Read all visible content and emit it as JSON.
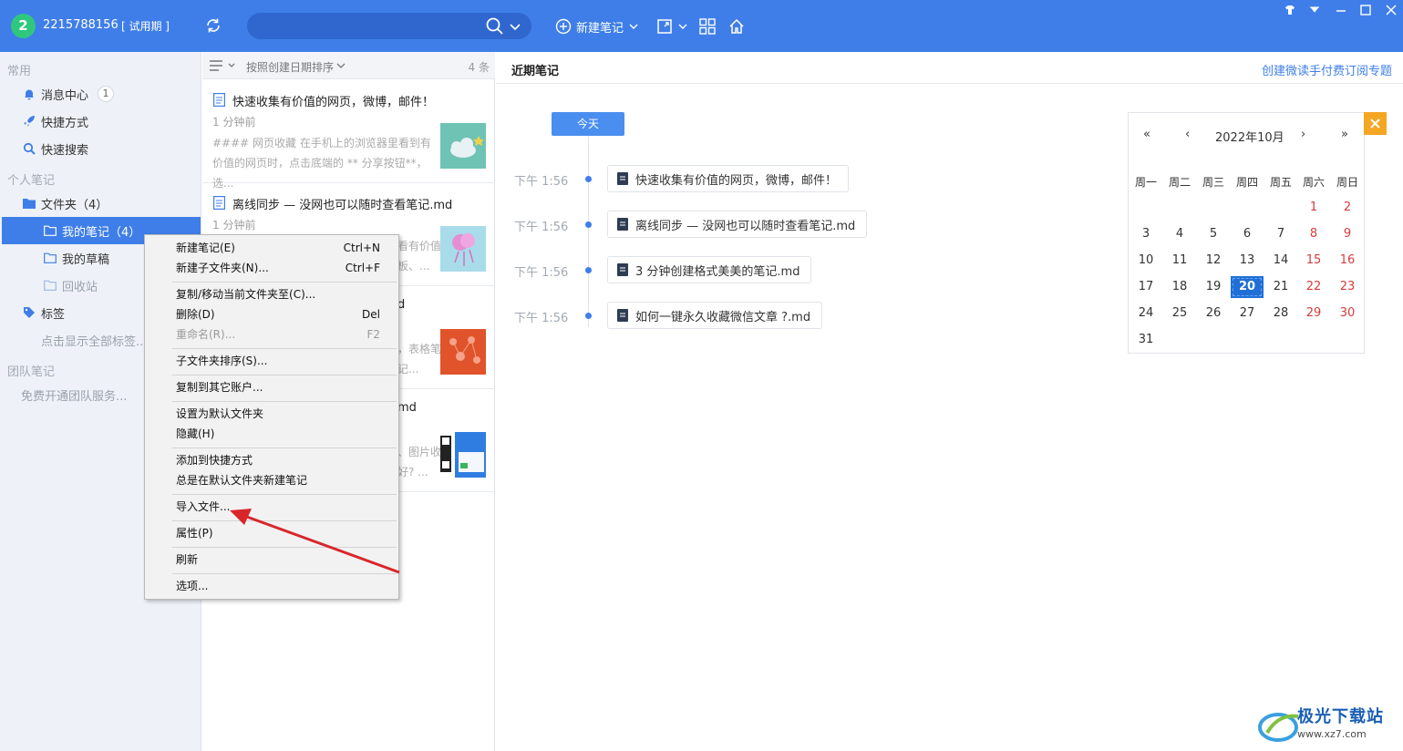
{
  "topbar": {
    "avatar_letter": "2",
    "user_id": "2215788156",
    "trial_label": "[ 试用期 ]",
    "search_placeholder": "",
    "new_note_label": "新建笔记"
  },
  "sidebar": {
    "common_title": "常用",
    "message_center": "消息中心",
    "message_count": "1",
    "shortcuts": "快捷方式",
    "quick_search": "快速搜索",
    "personal_title": "个人笔记",
    "folders": "文件夹（4）",
    "my_notes": "我的笔记（4）",
    "my_drafts": "我的草稿",
    "recycle_bin": "回收站",
    "tags": "标签",
    "tags_hint": "点击显示全部标签...",
    "team_title": "团队笔记",
    "team_hint": "免费开通团队服务..."
  },
  "notelist": {
    "sort_label": "按照创建日期排序",
    "count": "4 条",
    "notes": [
      {
        "title": "快速收集有价值的网页，微博，邮件！",
        "time": "1 分钟前",
        "snippet": "#### 网页收藏 在手机上的浏览器里看到有价值的网页时，点击底端的 ** 分享按钮**，选..."
      },
      {
        "title": "离线同步 — 没网也可以随时查看笔记.md",
        "time": "1 分钟前",
        "snippet": "看有价值板、..."
      },
      {
        "title": "d",
        "time": "",
        "snippet": "，表格笔记..."
      },
      {
        "title": "md",
        "time": "",
        "snippet": "、图片收好? ..."
      }
    ]
  },
  "main": {
    "title": "近期笔记",
    "link": "创建微读手付费订阅专题",
    "today_label": "今天",
    "timeline": [
      {
        "time": "下午 1:56",
        "title": "快速收集有价值的网页，微博，邮件！"
      },
      {
        "time": "下午 1:56",
        "title": "离线同步 — 没网也可以随时查看笔记.md"
      },
      {
        "time": "下午 1:56",
        "title": "3 分钟创建格式美美的笔记.md"
      },
      {
        "time": "下午 1:56",
        "title": "如何一键永久收藏微信文章 ?.md"
      }
    ]
  },
  "calendar": {
    "prev_year": "«",
    "prev_month": "‹",
    "month_label": "2022年10月",
    "next_month": "›",
    "next_year": "»",
    "weekdays": [
      "周一",
      "周二",
      "周三",
      "周四",
      "周五",
      "周六",
      "周日"
    ],
    "weeks": [
      [
        "",
        "",
        "",
        "",
        "",
        "1",
        "2"
      ],
      [
        "3",
        "4",
        "5",
        "6",
        "7",
        "8",
        "9"
      ],
      [
        "10",
        "11",
        "12",
        "13",
        "14",
        "15",
        "16"
      ],
      [
        "17",
        "18",
        "19",
        "20",
        "21",
        "22",
        "23"
      ],
      [
        "24",
        "25",
        "26",
        "27",
        "28",
        "29",
        "30"
      ],
      [
        "31",
        "",
        "",
        "",
        "",
        "",
        ""
      ]
    ],
    "today": "20"
  },
  "context_menu": {
    "items": [
      {
        "label": "新建笔记(E)",
        "shortcut": "Ctrl+N"
      },
      {
        "label": "新建子文件夹(N)...",
        "shortcut": "Ctrl+F"
      },
      {
        "label": "复制/移动当前文件夹至(C)...",
        "shortcut": ""
      },
      {
        "label": "删除(D)",
        "shortcut": "Del"
      },
      {
        "label": "重命名(R)...",
        "shortcut": "F2"
      },
      {
        "label": "子文件夹排序(S)...",
        "shortcut": ""
      },
      {
        "label": "复制到其它账户...",
        "shortcut": ""
      },
      {
        "label": "设置为默认文件夹",
        "shortcut": ""
      },
      {
        "label": "隐藏(H)",
        "shortcut": ""
      },
      {
        "label": "添加到快捷方式",
        "shortcut": ""
      },
      {
        "label": "总是在默认文件夹新建笔记",
        "shortcut": ""
      },
      {
        "label": "导入文件...",
        "shortcut": ""
      },
      {
        "label": "属性(P)",
        "shortcut": ""
      },
      {
        "label": "刷新",
        "shortcut": ""
      },
      {
        "label": "选项...",
        "shortcut": ""
      }
    ]
  },
  "watermark": {
    "brand": "极光下载站",
    "url": "www.xz7.com"
  },
  "colors": {
    "accent": "#3f7ee8",
    "weekend": "#d83b3b",
    "arrow": "#d9262b"
  }
}
